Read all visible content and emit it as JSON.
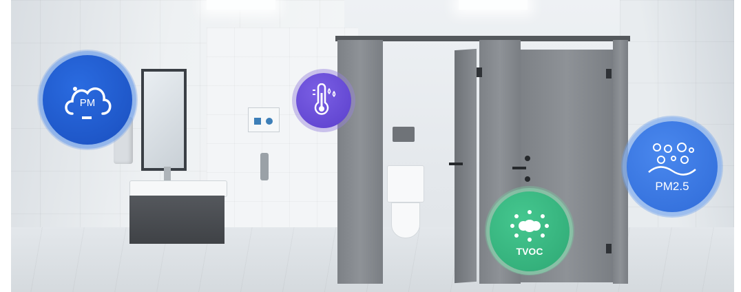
{
  "sensors": {
    "pm": {
      "label": "PM",
      "icon": "cloud-pm-icon",
      "color": "#1c56c9"
    },
    "temperature": {
      "icon": "thermometer-icon",
      "color": "#6a4fd6"
    },
    "tvoc": {
      "label": "TVOC",
      "icon": "molecule-dots-icon",
      "color": "#33b980"
    },
    "pm25": {
      "label": "PM2.5",
      "icon": "particles-icon",
      "color": "#3b78e2"
    }
  }
}
